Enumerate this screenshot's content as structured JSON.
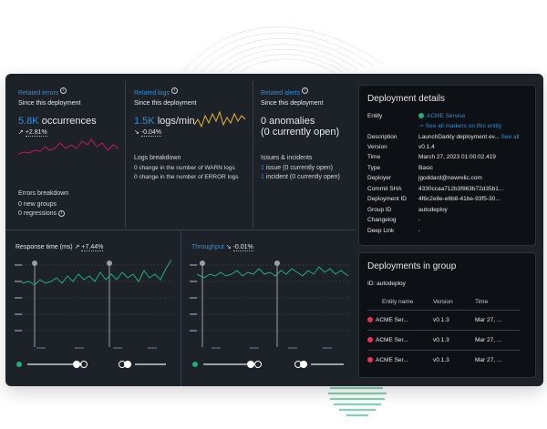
{
  "colors": {
    "panel_bg": "#1d2228",
    "card_bg": "#0d1014",
    "accent_blue": "#2f8fd8",
    "accent_green": "#1fae7a",
    "error_red": "#e0374f",
    "sparkline_pink": "#c2185b",
    "sparkline_yellow": "#e6b43a"
  },
  "errors": {
    "link": "Related errors",
    "subtitle": "Since this deployment",
    "value": "5.8K",
    "unit": " occurrences",
    "delta_arrow": "↗",
    "delta": "+2.81%",
    "breakdown_title": "Errors breakdown",
    "new_groups_count": "0",
    "new_groups_label": "new groups",
    "regressions_count": "0",
    "regressions_label": "regressions"
  },
  "logs": {
    "link": "Related logs",
    "subtitle": "Since this deployment",
    "value": "1.5K",
    "unit": " logs/min",
    "delta_arrow": "↘",
    "delta": "-0.04%",
    "breakdown_title": "Logs breakdown",
    "warn_count": "0",
    "warn_label": "change in the number of WARN logs",
    "error_count": "0",
    "error_label": "change in the number of ERROR logs"
  },
  "alerts": {
    "link": "Related alerts",
    "subtitle": "Since this deployment",
    "anomalies": "0 anomalies",
    "open": "(0 currently open)",
    "issues_title": "Issues & incidents",
    "issue_count": "1",
    "issue_label": "issue (0 currently open)",
    "incident_count": "1",
    "incident_label": "incident (0 currently open)"
  },
  "response_time": {
    "title": "Response time (ms)",
    "delta_arrow": "↗",
    "delta": "+7.44%"
  },
  "throughput": {
    "title": "Throughput",
    "delta_arrow": "↘",
    "delta": "-0.01%"
  },
  "deployment_details": {
    "title": "Deployment details",
    "entity_label": "Entity",
    "entity_value": "ACME Service",
    "markers_link": "-+ See all markers on this entity",
    "rows": [
      {
        "k": "Description",
        "v": "LaunchDarkly deployment ev...",
        "link": "See all"
      },
      {
        "k": "Version",
        "v": "v0.1.4"
      },
      {
        "k": "Time",
        "v": "March 27, 2023 01:00:02.419"
      },
      {
        "k": "Type",
        "v": "Basic"
      },
      {
        "k": "Deployer",
        "v": "jgoddard@newrelic.com"
      },
      {
        "k": "Commit SHA",
        "v": "4330ccaa712b3f863b72d35b1..."
      },
      {
        "k": "Deployment ID",
        "v": "4f6c2e8e-e6b8-41be-93f5-30..."
      },
      {
        "k": "Group ID",
        "v": "autodeploy"
      },
      {
        "k": "Changelog",
        "v": "-"
      },
      {
        "k": "Deep Link",
        "v": "-"
      }
    ]
  },
  "deployments_group": {
    "title": "Deployments in group",
    "group_id": "ID: autodeploy",
    "headers": [
      "Entity name",
      "Version",
      "Time"
    ],
    "rows": [
      {
        "name": "ACME Ser...",
        "version": "v0.1.3",
        "time": "Mar 27, ..."
      },
      {
        "name": "ACME Ser...",
        "version": "v0.1.3",
        "time": "Mar 27, ..."
      },
      {
        "name": "ACME Ser...",
        "version": "v0.1.3",
        "time": "Mar 27, ..."
      }
    ]
  }
}
